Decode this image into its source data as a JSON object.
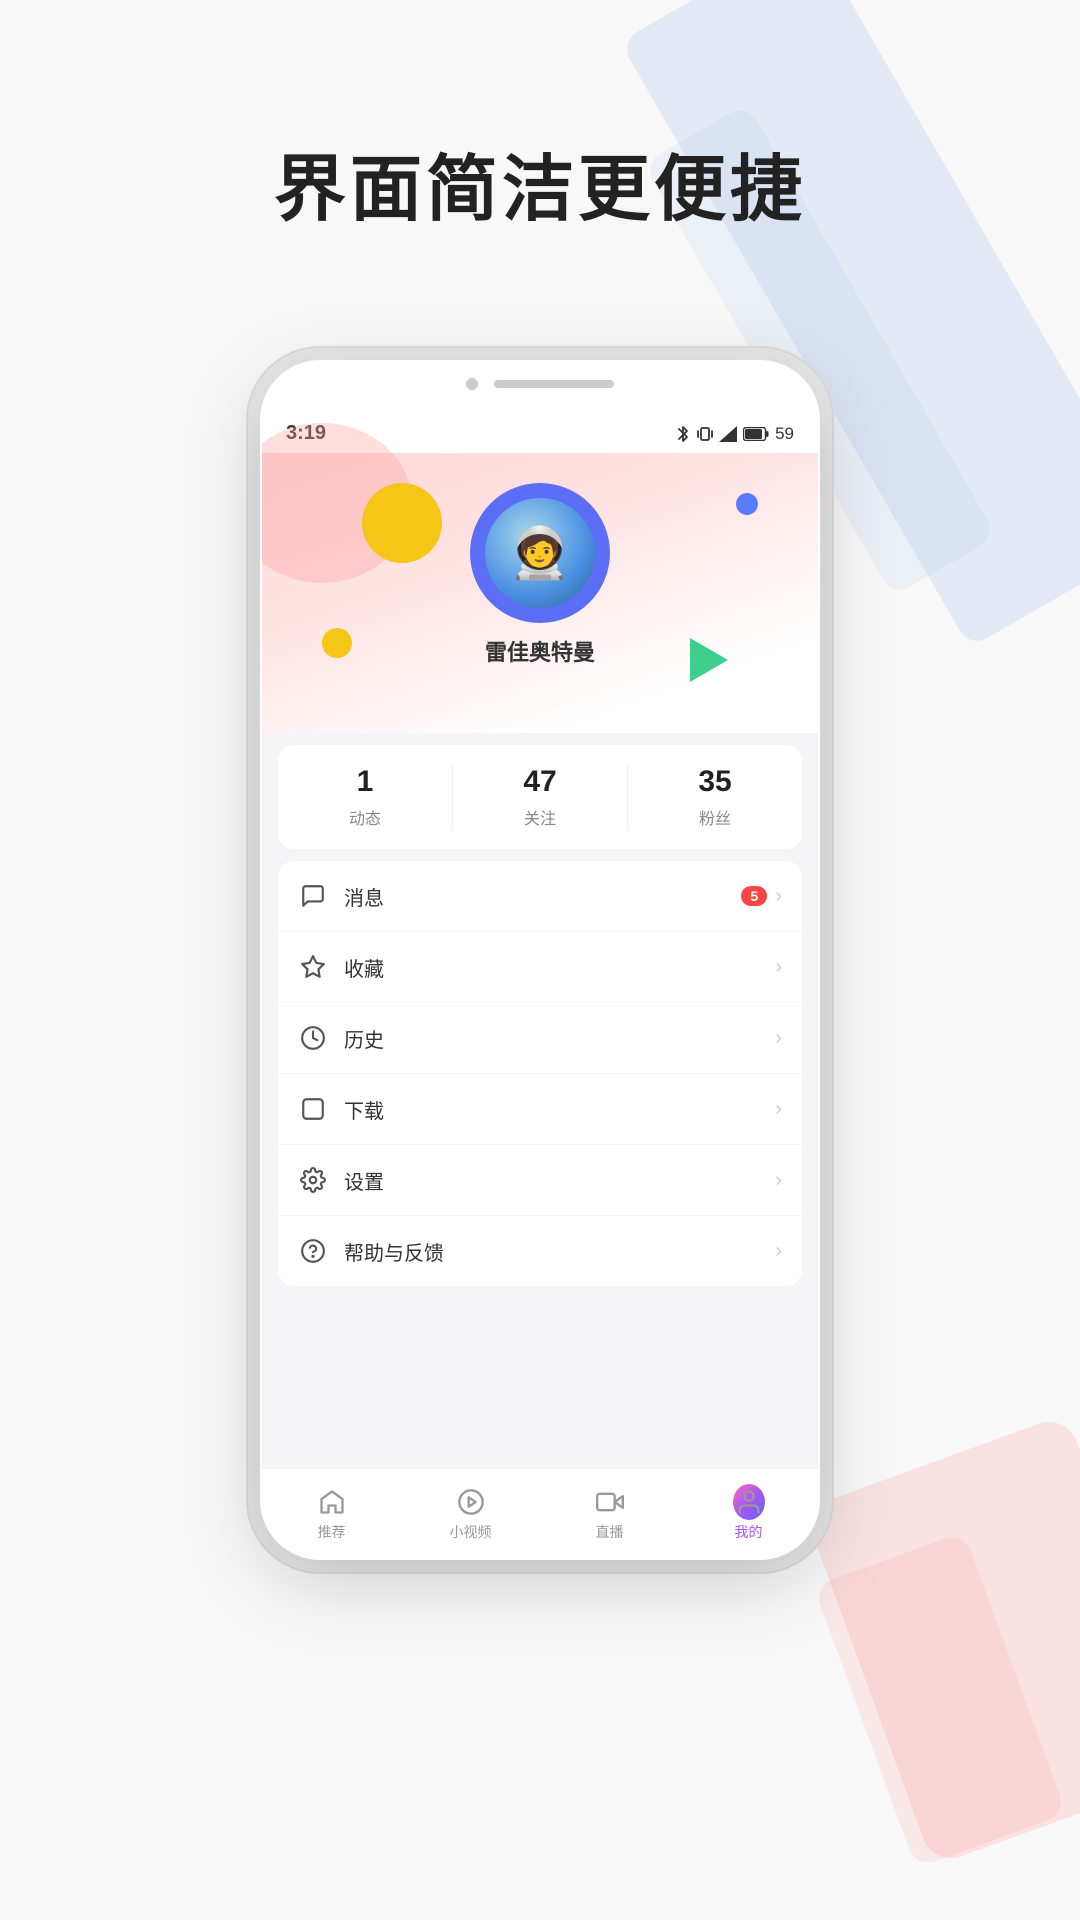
{
  "page": {
    "title": "界面简洁更便捷",
    "bg_stripes": true
  },
  "status_bar": {
    "time": "3:19",
    "battery": "59"
  },
  "profile": {
    "username": "雷佳奥特曼",
    "stats": [
      {
        "value": "1",
        "label": "动态"
      },
      {
        "value": "47",
        "label": "关注"
      },
      {
        "value": "35",
        "label": "粉丝"
      }
    ]
  },
  "menu": [
    {
      "id": "message",
      "label": "消息",
      "badge": "5",
      "icon": "chat"
    },
    {
      "id": "favorites",
      "label": "收藏",
      "badge": "",
      "icon": "star"
    },
    {
      "id": "history",
      "label": "历史",
      "badge": "",
      "icon": "clock"
    },
    {
      "id": "download",
      "label": "下载",
      "badge": "",
      "icon": "download"
    },
    {
      "id": "settings",
      "label": "设置",
      "badge": "",
      "icon": "settings"
    },
    {
      "id": "help",
      "label": "帮助与反馈",
      "badge": "",
      "icon": "help"
    }
  ],
  "bottom_nav": [
    {
      "id": "recommend",
      "label": "推荐",
      "icon": "home",
      "active": false
    },
    {
      "id": "short_video",
      "label": "小视频",
      "icon": "play-circle",
      "active": false
    },
    {
      "id": "live",
      "label": "直播",
      "icon": "video",
      "active": false
    },
    {
      "id": "mine",
      "label": "我的",
      "icon": "profile",
      "active": true
    }
  ]
}
